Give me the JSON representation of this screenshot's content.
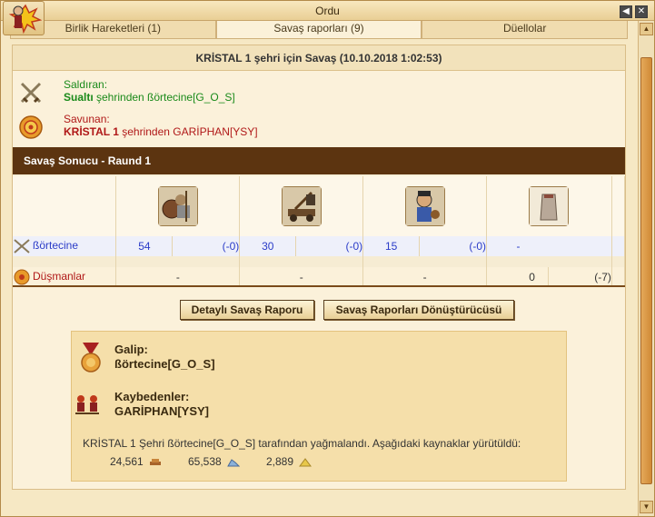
{
  "window": {
    "title": "Ordu"
  },
  "tabs": [
    {
      "label": "Birlik Hareketleri (1)"
    },
    {
      "label": "Savaş raporları (9)"
    },
    {
      "label": "Düellolar"
    }
  ],
  "battle": {
    "title": "KRİSTAL 1 şehri için Savaş (10.10.2018 1:02:53)",
    "attacker_label": "Saldıran:",
    "attacker_city": "Sualtı",
    "attacker_rest": " şehrinden ßörtecine[G_O_S]",
    "defender_label": "Savunan:",
    "defender_city": "KRİSTAL 1",
    "defender_rest": " şehrinden GARİPHAN[YSY]"
  },
  "round": {
    "title": "Savaş Sonucu - Raund 1"
  },
  "units": {
    "icons": [
      "hoplite-unit-icon",
      "catapult-unit-icon",
      "swordsman-unit-icon",
      "wall-unit-icon"
    ],
    "mine": {
      "name": "ßörtecine",
      "cells": [
        {
          "v": "54",
          "d": "(-0)"
        },
        {
          "v": "30",
          "d": "(-0)"
        },
        {
          "v": "15",
          "d": "(-0)"
        },
        {
          "v": "-",
          "d": ""
        }
      ]
    },
    "enemy": {
      "name": "Düşmanlar",
      "cells": [
        {
          "v": "-",
          "d": ""
        },
        {
          "v": "-",
          "d": ""
        },
        {
          "v": "-",
          "d": ""
        },
        {
          "v": "0",
          "d": "(-7)"
        }
      ]
    }
  },
  "buttons": {
    "detailed": "Detaylı Savaş Raporu",
    "converter": "Savaş Raporları Dönüştürücüsü"
  },
  "result": {
    "winner_label": "Galip:",
    "winner_name": "ßörtecine[G_O_S]",
    "losers_label": "Kaybedenler:",
    "losers_name": "GARİPHAN[YSY]",
    "plunder_text": "KRİSTAL 1 Şehri ßörtecine[G_O_S] tarafından yağmalandı. Aşağıdaki kaynaklar yürütüldü:",
    "resources": [
      {
        "amount": "24,561",
        "icon": "wood-icon"
      },
      {
        "amount": "65,538",
        "icon": "stone-icon"
      },
      {
        "amount": "2,889",
        "icon": "silver-icon"
      }
    ]
  },
  "colors": {
    "round_bar": "#5c3410",
    "attacker": "#1a8a1a",
    "defender": "#b01818",
    "numbers": "#2b3cc8"
  }
}
